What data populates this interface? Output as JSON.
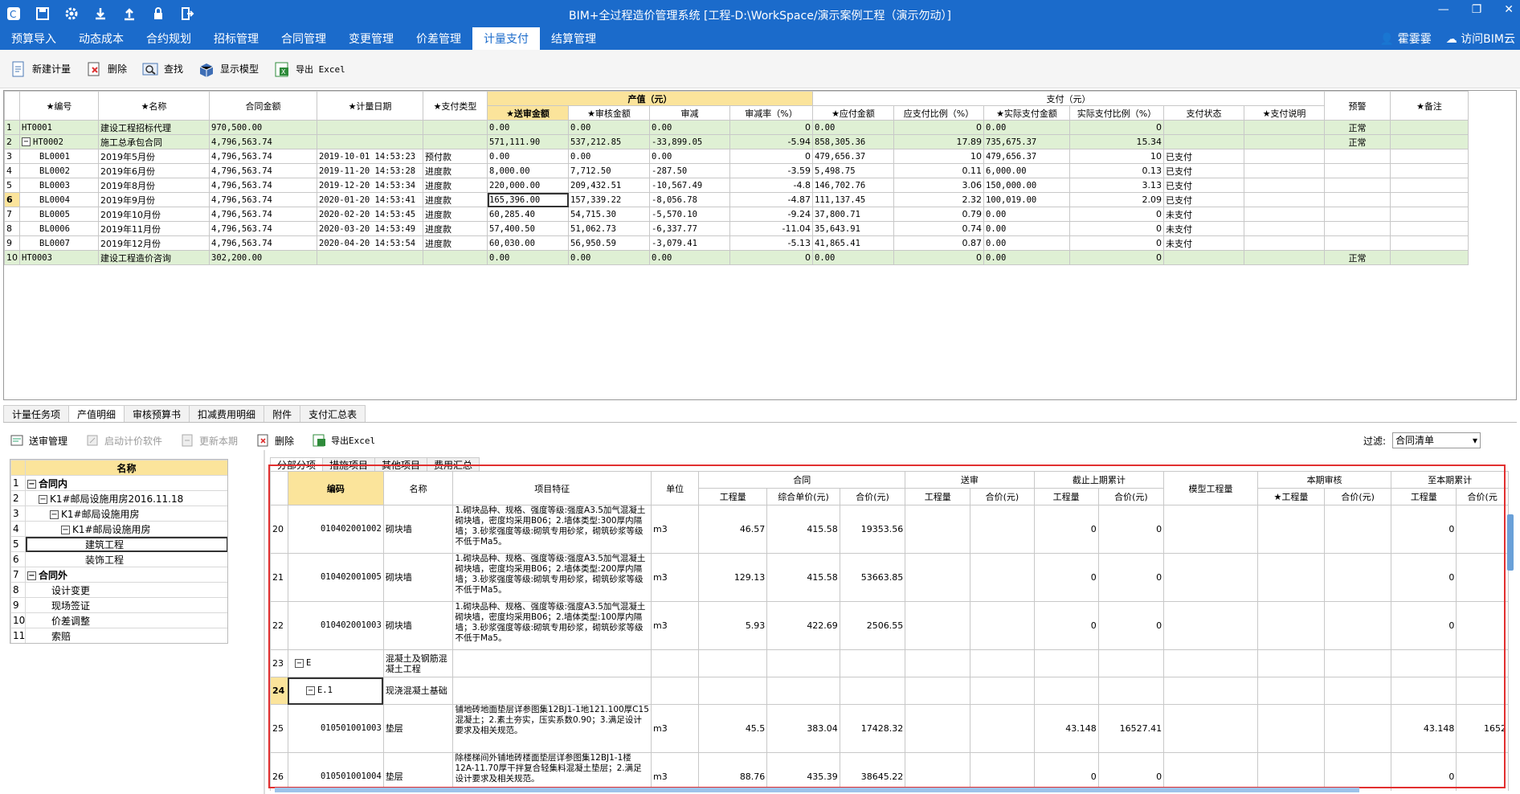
{
  "window": {
    "title": "BIM+全过程造价管理系统 [工程-D:\\WorkSpace/演示案例工程（演示勿动）]"
  },
  "quick_icons": [
    "app-icon",
    "save-icon",
    "gear-icon",
    "download-icon",
    "upload-icon",
    "lock-icon",
    "exit-icon"
  ],
  "menu": {
    "tabs": [
      "预算导入",
      "动态成本",
      "合约规划",
      "招标管理",
      "合同管理",
      "变更管理",
      "价差管理",
      "计量支付",
      "结算管理"
    ],
    "active": "计量支付",
    "user": "霍霎霎",
    "cloud": "访问BIM云"
  },
  "toolbar": {
    "new": "新建计量",
    "delete": "删除",
    "find": "查找",
    "show_model": "显示模型",
    "export": "导出 Excel"
  },
  "grid1": {
    "group_output": "产值（元）",
    "group_pay": "支付（元）",
    "headers": [
      "★编号",
      "★名称",
      "合同金额",
      "★计量日期",
      "★支付类型",
      "★送审金额",
      "★审核金额",
      "审减",
      "审减率（%）",
      "★应付金额",
      "应支付比例（%）",
      "★实际支付金额",
      "实际支付比例（%）",
      "支付状态",
      "★支付说明",
      "预警",
      "★备注"
    ],
    "rows": [
      {
        "n": "1",
        "code": "HT0001",
        "name": "建设工程招标代理",
        "amount": "970,500.00",
        "date": "",
        "type": "",
        "sub": "0.00",
        "aud": "0.00",
        "red": "0.00",
        "rate": "0",
        "payable": "0.00",
        "pr": "0",
        "actual": "0.00",
        "apr": "0",
        "status": "",
        "note": "",
        "warn": "正常",
        "remark": "",
        "g": true,
        "tog": ""
      },
      {
        "n": "2",
        "code": "HT0002",
        "name": "施工总承包合同",
        "amount": "4,796,563.74",
        "date": "",
        "type": "",
        "sub": "571,111.90",
        "aud": "537,212.85",
        "red": "-33,899.05",
        "rate": "-5.94",
        "payable": "858,305.36",
        "pr": "17.89",
        "actual": "735,675.37",
        "apr": "15.34",
        "status": "",
        "note": "",
        "warn": "正常",
        "remark": "",
        "g": true,
        "tog": "−"
      },
      {
        "n": "3",
        "code": "BL0001",
        "name": "2019年5月份",
        "amount": "4,796,563.74",
        "date": "2019-10-01 14:53:23",
        "type": "预付款",
        "sub": "0.00",
        "aud": "0.00",
        "red": "0.00",
        "rate": "0",
        "payable": "479,656.37",
        "pr": "10",
        "actual": "479,656.37",
        "apr": "10",
        "status": "已支付",
        "note": "",
        "warn": "",
        "remark": "",
        "g": false,
        "tog": ""
      },
      {
        "n": "4",
        "code": "BL0002",
        "name": "2019年6月份",
        "amount": "4,796,563.74",
        "date": "2019-11-20 14:53:28",
        "type": "进度款",
        "sub": "8,000.00",
        "aud": "7,712.50",
        "red": "-287.50",
        "rate": "-3.59",
        "payable": "5,498.75",
        "pr": "0.11",
        "actual": "6,000.00",
        "apr": "0.13",
        "status": "已支付",
        "note": "",
        "warn": "",
        "remark": "",
        "g": false,
        "tog": ""
      },
      {
        "n": "5",
        "code": "BL0003",
        "name": "2019年8月份",
        "amount": "4,796,563.74",
        "date": "2019-12-20 14:53:34",
        "type": "进度款",
        "sub": "220,000.00",
        "aud": "209,432.51",
        "red": "-10,567.49",
        "rate": "-4.8",
        "payable": "146,702.76",
        "pr": "3.06",
        "actual": "150,000.00",
        "apr": "3.13",
        "status": "已支付",
        "note": "",
        "warn": "",
        "remark": "",
        "g": false,
        "tog": ""
      },
      {
        "n": "6",
        "code": "BL0004",
        "name": "2019年9月份",
        "amount": "4,796,563.74",
        "date": "2020-01-20 14:53:41",
        "type": "进度款",
        "sub": "165,396.00",
        "aud": "157,339.22",
        "red": "-8,056.78",
        "rate": "-4.87",
        "payable": "111,137.45",
        "pr": "2.32",
        "actual": "100,019.00",
        "apr": "2.09",
        "status": "已支付",
        "note": "",
        "warn": "",
        "remark": "",
        "g": false,
        "tog": "",
        "cur": true
      },
      {
        "n": "7",
        "code": "BL0005",
        "name": "2019年10月份",
        "amount": "4,796,563.74",
        "date": "2020-02-20 14:53:45",
        "type": "进度款",
        "sub": "60,285.40",
        "aud": "54,715.30",
        "red": "-5,570.10",
        "rate": "-9.24",
        "payable": "37,800.71",
        "pr": "0.79",
        "actual": "0.00",
        "apr": "0",
        "status": "未支付",
        "note": "",
        "warn": "",
        "remark": "",
        "g": false,
        "tog": ""
      },
      {
        "n": "8",
        "code": "BL0006",
        "name": "2019年11月份",
        "amount": "4,796,563.74",
        "date": "2020-03-20 14:53:49",
        "type": "进度款",
        "sub": "57,400.50",
        "aud": "51,062.73",
        "red": "-6,337.77",
        "rate": "-11.04",
        "payable": "35,643.91",
        "pr": "0.74",
        "actual": "0.00",
        "apr": "0",
        "status": "未支付",
        "note": "",
        "warn": "",
        "remark": "",
        "g": false,
        "tog": ""
      },
      {
        "n": "9",
        "code": "BL0007",
        "name": "2019年12月份",
        "amount": "4,796,563.74",
        "date": "2020-04-20 14:53:54",
        "type": "进度款",
        "sub": "60,030.00",
        "aud": "56,950.59",
        "red": "-3,079.41",
        "rate": "-5.13",
        "payable": "41,865.41",
        "pr": "0.87",
        "actual": "0.00",
        "apr": "0",
        "status": "未支付",
        "note": "",
        "warn": "",
        "remark": "",
        "g": false,
        "tog": ""
      },
      {
        "n": "10",
        "code": "HT0003",
        "name": "建设工程造价咨询",
        "amount": "302,200.00",
        "date": "",
        "type": "",
        "sub": "0.00",
        "aud": "0.00",
        "red": "0.00",
        "rate": "0",
        "payable": "0.00",
        "pr": "0",
        "actual": "0.00",
        "apr": "0",
        "status": "",
        "note": "",
        "warn": "正常",
        "remark": "",
        "g": true,
        "tog": ""
      }
    ]
  },
  "bottom_tabs": [
    "计量任务项",
    "产值明细",
    "审核预算书",
    "扣减费用明细",
    "附件",
    "支付汇总表"
  ],
  "bottom_active": "产值明细",
  "toolbar2": {
    "send": "送审管理",
    "launch": "启动计价软件",
    "update": "更新本期",
    "delete": "删除",
    "export": "导出Excel"
  },
  "filter": {
    "label": "过滤:",
    "value": "合同清单"
  },
  "tree": {
    "header": "名称",
    "rows": [
      {
        "n": "1",
        "label": "合同内",
        "indent": 0,
        "tog": "−",
        "bold": true
      },
      {
        "n": "2",
        "label": "K1#邮局设施用房2016.11.18",
        "indent": 1,
        "tog": "−",
        "bold": false
      },
      {
        "n": "3",
        "label": "K1#邮局设施用房",
        "indent": 2,
        "tog": "−",
        "bold": false
      },
      {
        "n": "4",
        "label": "K1#邮局设施用房",
        "indent": 3,
        "tog": "−",
        "bold": false
      },
      {
        "n": "5",
        "label": "建筑工程",
        "indent": 4,
        "tog": "",
        "bold": false,
        "sel": true
      },
      {
        "n": "6",
        "label": "装饰工程",
        "indent": 4,
        "tog": "",
        "bold": false
      },
      {
        "n": "7",
        "label": "合同外",
        "indent": 0,
        "tog": "−",
        "bold": true
      },
      {
        "n": "8",
        "label": "设计变更",
        "indent": 1,
        "tog": "",
        "bold": false
      },
      {
        "n": "9",
        "label": "现场签证",
        "indent": 1,
        "tog": "",
        "bold": false
      },
      {
        "n": "10",
        "label": "价差调整",
        "indent": 1,
        "tog": "",
        "bold": false
      },
      {
        "n": "11",
        "label": "索赔",
        "indent": 1,
        "tog": "",
        "bold": false
      }
    ]
  },
  "subtabs": [
    "分部分项",
    "措施项目",
    "其他项目",
    "费用汇总"
  ],
  "subtab_active": "分部分项",
  "grid2": {
    "groups": {
      "contract": "合同",
      "submit": "送审",
      "prev": "截止上期累计",
      "model": "模型工程量",
      "audit": "本期审核",
      "total": "至本期累计"
    },
    "headers": {
      "code": "编码",
      "name": "名称",
      "feature": "项目特征",
      "unit": "单位",
      "qty": "工程量",
      "uprice": "综合单价(元)",
      "total": "合价(元)",
      "sqty": "工程量",
      "stotal": "合价(元)",
      "pqty": "工程量",
      "ptotal": "合价(元)",
      "aqty": "★工程量",
      "atotal": "合价(元)",
      "tqty": "工程量",
      "ttotal": "合价(元"
    },
    "rows": [
      {
        "n": "20",
        "code": "010402001002",
        "name": "砌块墙",
        "feature": "1.砌块品种、规格、强度等级:强度A3.5加气混凝土砌块墙，密度均采用B06；2.墙体类型:300厚内隔墙；3.砂浆强度等级:砌筑专用砂浆，砌筑砂浆等级不低于Ma5。",
        "unit": "m3",
        "qty": "46.57",
        "uprice": "415.58",
        "total": "19353.56",
        "pqty": "0",
        "ptotal": "0",
        "tqty": "0",
        "ttotal": "",
        "tog": ""
      },
      {
        "n": "21",
        "code": "010402001005",
        "name": "砌块墙",
        "feature": "1.砌块品种、规格、强度等级:强度A3.5加气混凝土砌块墙，密度均采用B06；2.墙体类型:200厚内隔墙；3.砂浆强度等级:砌筑专用砂浆，砌筑砂浆等级不低于Ma5。",
        "unit": "m3",
        "qty": "129.13",
        "uprice": "415.58",
        "total": "53663.85",
        "pqty": "0",
        "ptotal": "0",
        "tqty": "0",
        "ttotal": "",
        "tog": ""
      },
      {
        "n": "22",
        "code": "010402001003",
        "name": "砌块墙",
        "feature": "1.砌块品种、规格、强度等级:强度A3.5加气混凝土砌块墙，密度均采用B06；2.墙体类型:100厚内隔墙；3.砂浆强度等级:砌筑专用砂浆，砌筑砂浆等级不低于Ma5。",
        "unit": "m3",
        "qty": "5.93",
        "uprice": "422.69",
        "total": "2506.55",
        "pqty": "0",
        "ptotal": "0",
        "tqty": "0",
        "ttotal": "",
        "tog": ""
      },
      {
        "n": "23",
        "code": "E",
        "name": "混凝土及钢筋混凝土工程",
        "feature": "",
        "unit": "",
        "qty": "",
        "uprice": "",
        "total": "",
        "pqty": "",
        "ptotal": "",
        "tqty": "",
        "ttotal": "",
        "tog": "−"
      },
      {
        "n": "24",
        "code": "E.1",
        "name": "现浇混凝土基础",
        "feature": "",
        "unit": "",
        "qty": "",
        "uprice": "",
        "total": "",
        "pqty": "",
        "ptotal": "",
        "tqty": "",
        "ttotal": "",
        "tog": "−",
        "cur": true
      },
      {
        "n": "25",
        "code": "010501001003",
        "name": "垫层",
        "feature": "铺地砖地面垫层详参图集12BJ1-1地121.100厚C15混凝土；2.素土夯实，压实系数0.90；3.满足设计要求及相关规范。",
        "unit": "m3",
        "qty": "45.5",
        "uprice": "383.04",
        "total": "17428.32",
        "pqty": "43.148",
        "ptotal": "16527.41",
        "tqty": "43.148",
        "ttotal": "1652",
        "tog": ""
      },
      {
        "n": "26",
        "code": "010501001004",
        "name": "垫层",
        "feature": "除楼梯间外铺地砖楼面垫层详参图集12BJ1-1楼12A-11.70厚干拌复合轻集料混凝土垫层；2.满足设计要求及相关规范。",
        "unit": "m3",
        "qty": "88.76",
        "uprice": "435.39",
        "total": "38645.22",
        "pqty": "0",
        "ptotal": "0",
        "tqty": "0",
        "ttotal": "",
        "tog": ""
      }
    ]
  }
}
